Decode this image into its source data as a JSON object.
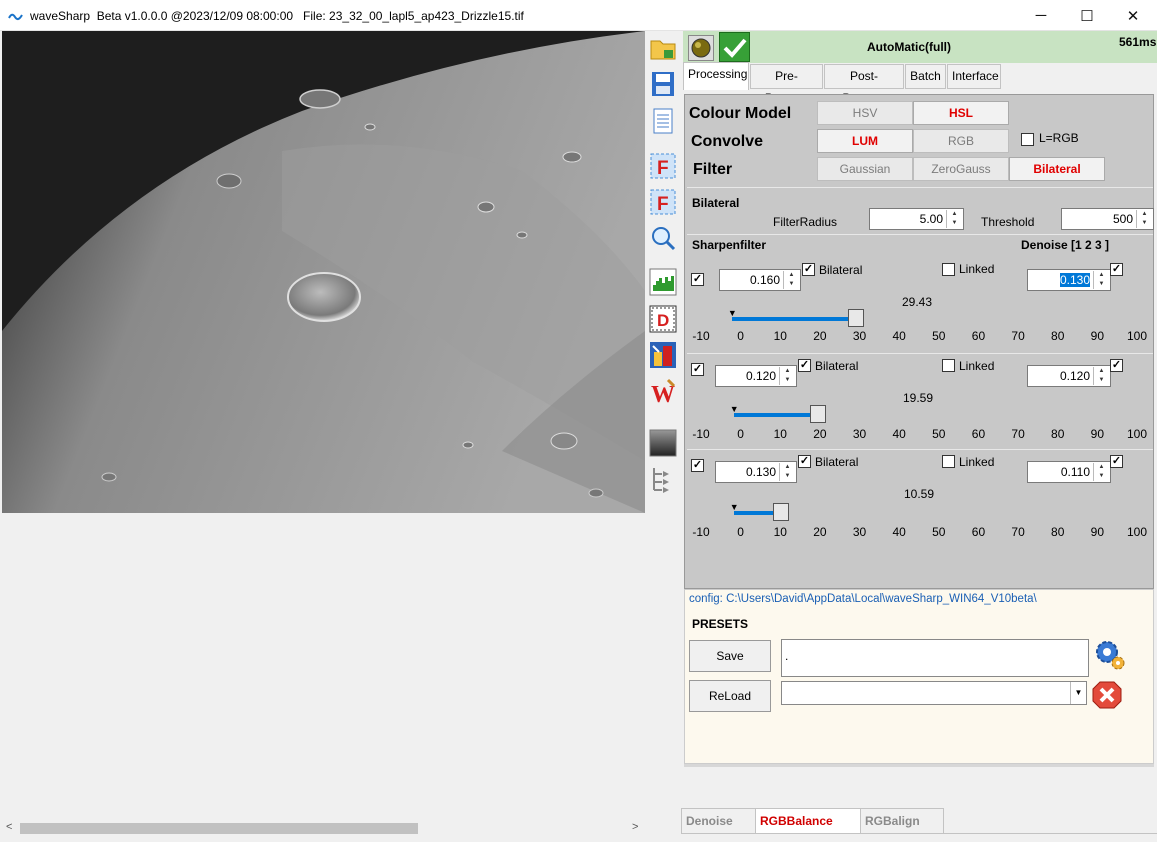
{
  "window": {
    "title": "waveSharp  Beta v1.0.0.0 @2023/12/09 08:00:00   File: 23_32_00_lapl5_ap423_Drizzle15.tif",
    "minimize": "─",
    "maximize": "☐",
    "close": "✕"
  },
  "status": {
    "mode": "AutoMatic(full)",
    "time": "561ms"
  },
  "tabs": [
    "Processing",
    "Pre-Process",
    "Post-Process",
    "Batch",
    "Interface"
  ],
  "colour_model": {
    "label": "Colour Model",
    "options": [
      "HSV",
      "HSL"
    ],
    "selected": "HSL"
  },
  "convolve": {
    "label": "Convolve",
    "options": [
      "LUM",
      "RGB"
    ],
    "selected": "LUM",
    "lrgb_label": "L=RGB",
    "lrgb_checked": false
  },
  "filter": {
    "label": "Filter",
    "options": [
      "Gaussian",
      "ZeroGauss",
      "Bilateral"
    ],
    "selected": "Bilateral"
  },
  "bilateral": {
    "title": "Bilateral",
    "radius_label": "FilterRadius",
    "radius_value": "5.00",
    "threshold_label": "Threshold",
    "threshold_value": "500"
  },
  "sharpen": {
    "title": "Sharpenfilter",
    "denoise_title": "Denoise [1 2 3 ]",
    "ticks": [
      "-10",
      "0",
      "10",
      "20",
      "30",
      "40",
      "50",
      "60",
      "70",
      "80",
      "90",
      "100"
    ],
    "layers": [
      {
        "enabled": true,
        "value": "0.160",
        "bilateral_label": "Bilateral",
        "bilateral": true,
        "linked_label": "Linked",
        "linked": false,
        "denoise": "0.130",
        "denoise_checked": true,
        "slider_value": "29.43",
        "level": 29.43
      },
      {
        "enabled": true,
        "value": "0.120",
        "bilateral_label": "Bilateral",
        "bilateral": true,
        "linked_label": "Linked",
        "linked": false,
        "denoise": "0.120",
        "denoise_checked": true,
        "slider_value": "19.59",
        "level": 19.59
      },
      {
        "enabled": true,
        "value": "0.130",
        "bilateral_label": "Bilateral",
        "bilateral": true,
        "linked_label": "Linked",
        "linked": false,
        "denoise": "0.110",
        "denoise_checked": true,
        "slider_value": "10.59",
        "level": 10.59
      }
    ]
  },
  "config": {
    "path": "config: C:\\Users\\David\\AppData\\Local\\waveSharp_WIN64_V10beta\\"
  },
  "presets": {
    "title": "PRESETS",
    "save_label": "Save",
    "reload_label": "ReLoad",
    "save_value": ".",
    "reload_value": ""
  },
  "bottom_tabs": [
    "Denoise",
    "RGBBalance",
    "RGBalign"
  ],
  "bottom_selected": "RGBBalance",
  "colors": {
    "accent": "#0078d7",
    "selected_text": "#e00000",
    "status_bg": "#c8e3c2",
    "panel_bg": "#c8c8c8",
    "presets_bg": "#fdf9ee"
  }
}
